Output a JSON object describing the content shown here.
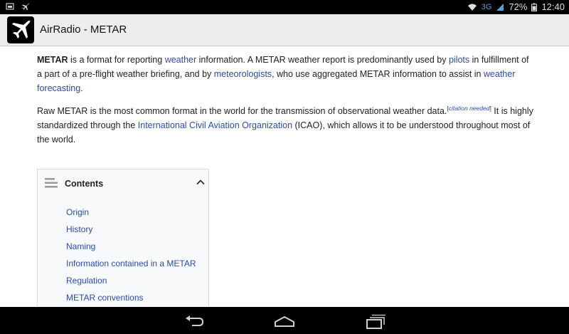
{
  "status_bar": {
    "network": "3G",
    "battery": "72%",
    "time": "12:40",
    "icons": [
      "image-icon",
      "airplane-icon",
      "wifi-icon",
      "signal-icon",
      "battery-icon"
    ]
  },
  "app": {
    "title": "AirRadio - METAR",
    "icon": "airplane-icon"
  },
  "article": {
    "p1": {
      "term": "METAR",
      "t1": " is a format for reporting ",
      "l1": "weather",
      "t2": " information. A METAR weather report is predominantly used by ",
      "l2": "pilots",
      "t3": " in fulfillment of a part of a pre-flight weather briefing, and by ",
      "l3": "meteorologists",
      "t4": ", who use aggregated METAR information to assist in ",
      "l4": "weather forecasting",
      "t5": "."
    },
    "p2": {
      "t1": "Raw METAR is the most common format in the world for the transmission of observational weather data.",
      "cite_open": "[",
      "cite": "citation needed",
      "cite_close": "]",
      "t2": " It is highly standardized through the ",
      "l1": "International Civil Aviation Organization",
      "t3": " (ICAO), which allows it to be understood throughout most of the world."
    }
  },
  "toc": {
    "title": "Contents",
    "items": [
      "Origin",
      "History",
      "Naming",
      "Information contained in a METAR",
      "Regulation",
      "METAR conventions"
    ]
  },
  "nav_bar": {
    "icons": [
      "back-icon",
      "home-icon",
      "recent-apps-icon"
    ]
  },
  "colors": {
    "link": "#2a4bb3",
    "status_bar": "#000000",
    "action_bar": "#ededed",
    "network_accent": "#4fa3d8"
  }
}
